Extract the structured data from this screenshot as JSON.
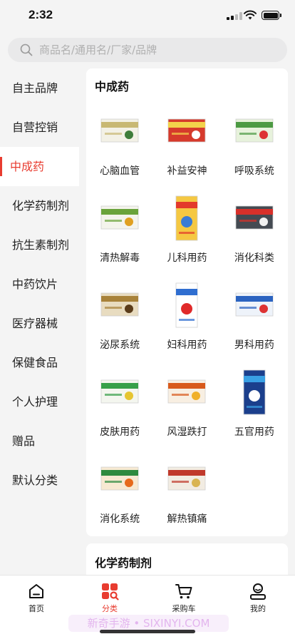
{
  "status_bar": {
    "time": "2:32"
  },
  "search": {
    "placeholder": "商品名/通用名/厂家/品牌"
  },
  "sidebar": {
    "items": [
      {
        "label": "自主品牌"
      },
      {
        "label": "自营控销"
      },
      {
        "label": "中成药"
      },
      {
        "label": "化学药制剂"
      },
      {
        "label": "抗生素制剂"
      },
      {
        "label": "中药饮片"
      },
      {
        "label": "医疗器械"
      },
      {
        "label": "保健食品"
      },
      {
        "label": "个人护理"
      },
      {
        "label": "赠品"
      },
      {
        "label": "默认分类"
      }
    ],
    "active_index": 2
  },
  "section": {
    "title": "中成药",
    "items": [
      {
        "label": "心脑血管",
        "icon": "medicine-box-icon"
      },
      {
        "label": "补益安神",
        "icon": "medicine-box-icon"
      },
      {
        "label": "呼吸系统",
        "icon": "medicine-box-icon"
      },
      {
        "label": "清热解毒",
        "icon": "medicine-box-icon"
      },
      {
        "label": "儿科用药",
        "icon": "medicine-box-icon"
      },
      {
        "label": "消化科类",
        "icon": "medicine-box-icon"
      },
      {
        "label": "泌尿系统",
        "icon": "medicine-box-icon"
      },
      {
        "label": "妇科用药",
        "icon": "medicine-box-icon"
      },
      {
        "label": "男科用药",
        "icon": "medicine-box-icon"
      },
      {
        "label": "皮肤用药",
        "icon": "medicine-box-icon"
      },
      {
        "label": "风湿跌打",
        "icon": "medicine-box-icon"
      },
      {
        "label": "五官用药",
        "icon": "medicine-box-icon"
      },
      {
        "label": "消化系统",
        "icon": "medicine-box-icon"
      },
      {
        "label": "解热镇痛",
        "icon": "medicine-box-icon"
      }
    ]
  },
  "next_section": {
    "title": "化学药制剂"
  },
  "tabbar": {
    "tabs": [
      {
        "label": "首页",
        "icon": "home-icon"
      },
      {
        "label": "分类",
        "icon": "category-icon"
      },
      {
        "label": "采购车",
        "icon": "cart-icon"
      },
      {
        "label": "我的",
        "icon": "profile-icon"
      }
    ],
    "active_index": 1
  },
  "watermark": "新奇手游 • SIXINYI.COM",
  "colors": {
    "accent": "#e83c30",
    "background": "#f4f4f4"
  }
}
